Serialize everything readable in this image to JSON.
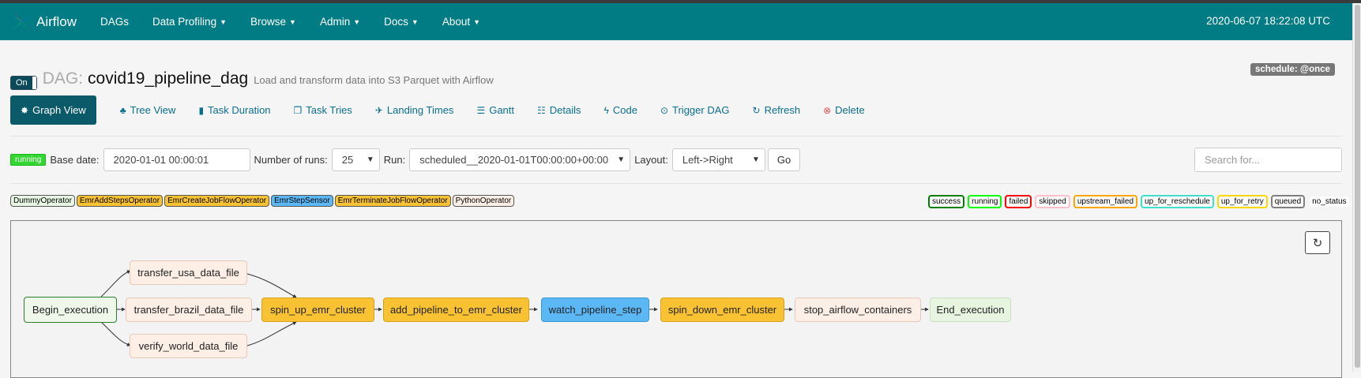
{
  "navbar": {
    "brand": "Airflow",
    "items": [
      {
        "label": "DAGs",
        "dropdown": false
      },
      {
        "label": "Data Profiling",
        "dropdown": true
      },
      {
        "label": "Browse",
        "dropdown": true
      },
      {
        "label": "Admin",
        "dropdown": true
      },
      {
        "label": "Docs",
        "dropdown": true
      },
      {
        "label": "About",
        "dropdown": true
      }
    ],
    "clock": "2020-06-07 18:22:08 UTC"
  },
  "dag": {
    "toggle_label": "On",
    "prefix": "DAG:",
    "id": "covid19_pipeline_dag",
    "description": "Load and transform data into S3 Parquet with Airflow",
    "schedule": "schedule: @once"
  },
  "tabs": [
    {
      "label": "Graph View",
      "icon": "asterisk-icon",
      "active": true
    },
    {
      "label": "Tree View",
      "icon": "tree-icon"
    },
    {
      "label": "Task Duration",
      "icon": "bar-chart-icon"
    },
    {
      "label": "Task Tries",
      "icon": "duplicate-icon"
    },
    {
      "label": "Landing Times",
      "icon": "plane-icon"
    },
    {
      "label": "Gantt",
      "icon": "align-left-icon"
    },
    {
      "label": "Details",
      "icon": "list-icon"
    },
    {
      "label": "Code",
      "icon": "flash-icon"
    },
    {
      "label": "Trigger DAG",
      "icon": "play-circle-icon"
    },
    {
      "label": "Refresh",
      "icon": "refresh-icon"
    },
    {
      "label": "Delete",
      "icon": "remove-circle-icon"
    }
  ],
  "form": {
    "state_badge": "running",
    "base_date_label": "Base date:",
    "base_date_value": "2020-01-01 00:00:01",
    "num_runs_label": "Number of runs:",
    "num_runs_value": "25",
    "run_label": "Run:",
    "run_value": "scheduled__2020-01-01T00:00:00+00:00",
    "layout_label": "Layout:",
    "layout_value": "Left->Right",
    "go_label": "Go",
    "search_placeholder": "Search for..."
  },
  "operators": [
    {
      "label": "DummyOperator",
      "color": "#e8f7e4"
    },
    {
      "label": "EmrAddStepsOperator",
      "color": "#f9c233"
    },
    {
      "label": "EmrCreateJobFlowOperator",
      "color": "#f9c233"
    },
    {
      "label": "EmrStepSensor",
      "color": "#5bb8f5"
    },
    {
      "label": "EmrTerminateJobFlowOperator",
      "color": "#f9c233"
    },
    {
      "label": "PythonOperator",
      "color": "#fdeee6"
    }
  ],
  "states": [
    {
      "label": "success",
      "color": "#008000"
    },
    {
      "label": "running",
      "color": "#00ff00"
    },
    {
      "label": "failed",
      "color": "#ff0000"
    },
    {
      "label": "skipped",
      "color": "#ffc0cb"
    },
    {
      "label": "upstream_failed",
      "color": "#ffa500"
    },
    {
      "label": "up_for_reschedule",
      "color": "#40e0d0"
    },
    {
      "label": "up_for_retry",
      "color": "#ffd700"
    },
    {
      "label": "queued",
      "color": "#808080"
    },
    {
      "label": "no_status",
      "color": ""
    }
  ],
  "graph": {
    "refresh_icon": "refresh-icon",
    "tasks": {
      "begin": "Begin_execution",
      "usa": "transfer_usa_data_file",
      "brazil": "transfer_brazil_data_file",
      "world": "verify_world_data_file",
      "spin_up": "spin_up_emr_cluster",
      "add_pipeline": "add_pipeline_to_emr_cluster",
      "watch": "watch_pipeline_step",
      "spin_down": "spin_down_emr_cluster",
      "stop": "stop_airflow_containers",
      "end": "End_execution"
    }
  }
}
